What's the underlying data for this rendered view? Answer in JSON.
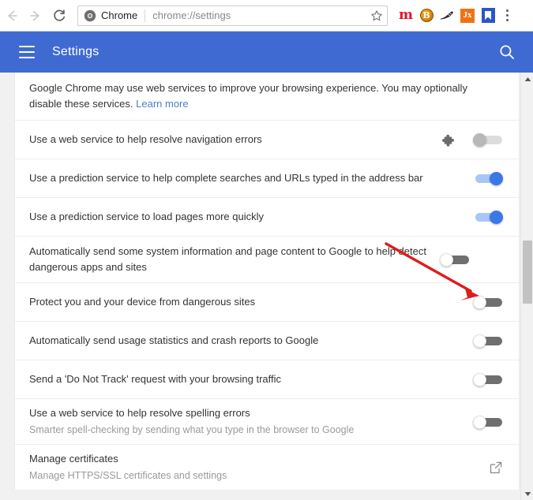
{
  "browser": {
    "back_icon": "back-arrow-icon",
    "forward_icon": "forward-arrow-icon",
    "reload_icon": "reload-icon",
    "omnibox": {
      "site_chip_label": "Chrome",
      "url": "chrome://settings",
      "star_icon": "bookmark-star-icon"
    },
    "extensions": [
      {
        "name": "extension-m",
        "glyph": "m",
        "color": "#e8102a"
      },
      {
        "name": "extension-bitcoin",
        "glyph": "B",
        "color": "#e08a0b"
      },
      {
        "name": "extension-sneaker",
        "glyph": "",
        "color": "#3a3a3a"
      },
      {
        "name": "extension-jx",
        "glyph": "Jx",
        "color": "#ef7215"
      },
      {
        "name": "extension-bookmark",
        "glyph": "",
        "color": "#2a56c6"
      }
    ],
    "menu_icon": "three-dot-menu-icon"
  },
  "settings_header": {
    "menu_icon": "hamburger-menu-icon",
    "title": "Settings",
    "search_icon": "search-icon"
  },
  "intro": {
    "text": "Google Chrome may use web services to improve your browsing experience. You may optionally disable these services. ",
    "link_label": "Learn more"
  },
  "rows": [
    {
      "label": "Use a web service to help resolve navigation errors",
      "sublabel": "",
      "control": "toggle",
      "state": "disabled",
      "has_puzzle_icon": true
    },
    {
      "label": "Use a prediction service to help complete searches and URLs typed in the address bar",
      "sublabel": "",
      "control": "toggle",
      "state": "on",
      "has_puzzle_icon": false
    },
    {
      "label": "Use a prediction service to load pages more quickly",
      "sublabel": "",
      "control": "toggle",
      "state": "on",
      "has_puzzle_icon": false
    },
    {
      "label": "Automatically send some system information and page content to Google to help detect dangerous apps and sites",
      "sublabel": "",
      "control": "toggle",
      "state": "off",
      "has_puzzle_icon": false
    },
    {
      "label": "Protect you and your device from dangerous sites",
      "sublabel": "",
      "control": "toggle",
      "state": "off",
      "has_puzzle_icon": false
    },
    {
      "label": "Automatically send usage statistics and crash reports to Google",
      "sublabel": "",
      "control": "toggle",
      "state": "off",
      "has_puzzle_icon": false
    },
    {
      "label": "Send a 'Do Not Track' request with your browsing traffic",
      "sublabel": "",
      "control": "toggle",
      "state": "off",
      "has_puzzle_icon": false
    },
    {
      "label": "Use a web service to help resolve spelling errors",
      "sublabel": "Smarter spell-checking by sending what you type in the browser to Google",
      "control": "toggle",
      "state": "off",
      "has_puzzle_icon": false
    },
    {
      "label": "Manage certificates",
      "sublabel": "Manage HTTPS/SSL certificates and settings",
      "control": "external-link",
      "state": "",
      "has_puzzle_icon": false
    }
  ],
  "annotation": {
    "type": "arrow",
    "color": "#e01b1b",
    "points_to": "Protect you and your device from dangerous sites toggle"
  },
  "scrollbar": {
    "up_icon": "scroll-up-arrow-icon",
    "down_icon": "scroll-down-arrow-icon"
  },
  "colors": {
    "header_blue": "#3f6ad2",
    "toggle_on": "#3b78e7",
    "toggle_on_track": "#a8c6f7",
    "toggle_off_track": "#6f6f6f",
    "link": "#4a7ec4",
    "annotation_red": "#e01b1b"
  }
}
